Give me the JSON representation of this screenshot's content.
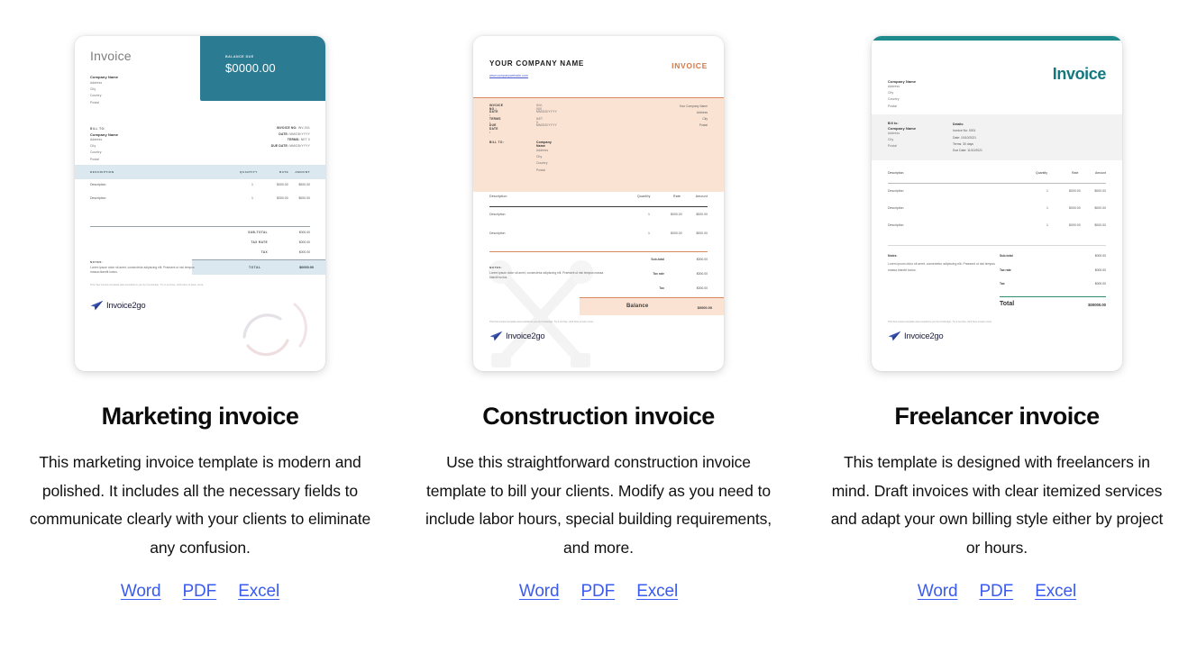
{
  "templates": [
    {
      "id": "marketing",
      "title": "Marketing invoice",
      "description": "This marketing invoice template is modern and polished. It includes all the necessary fields to communicate clearly with your clients to eliminate any confusion.",
      "links": [
        {
          "label": "Word"
        },
        {
          "label": "PDF"
        },
        {
          "label": "Excel"
        }
      ],
      "preview": {
        "heading": "Invoice",
        "balance_due_label": "BALANCE DUE",
        "balance_due_amount": "$0000.00",
        "accent_color": "#2b7b92",
        "table_header_color": "#dbe8ef",
        "from": {
          "company": "Company Name",
          "lines": [
            "Address",
            "City",
            "Country",
            "Postal"
          ]
        },
        "bill_to_label": "BILL TO:",
        "bill_to": {
          "company": "Company Name",
          "lines": [
            "Address",
            "City",
            "Country",
            "Postal"
          ]
        },
        "meta": [
          {
            "label": "INVOICE NO:",
            "value": "INV-001"
          },
          {
            "label": "DATE:",
            "value": "MM/DD/YYYY"
          },
          {
            "label": "TERMS:",
            "value": "NET 0"
          },
          {
            "label": "DUE DATE:",
            "value": "MM/DD/YYYY"
          }
        ],
        "columns": [
          "DESCRIPTION",
          "QUANTITY",
          "RATE",
          "AMOUNT"
        ],
        "rows": [
          {
            "description": "Description",
            "quantity": "1",
            "rate": "$000.00",
            "amount": "$000.00"
          },
          {
            "description": "Description",
            "quantity": "1",
            "rate": "$000.00",
            "amount": "$000.00"
          }
        ],
        "totals": [
          {
            "label": "SUB-TOTAL",
            "value": "$000.00"
          },
          {
            "label": "TAX RATE",
            "value": "$000.00"
          },
          {
            "label": "TAX",
            "value": "$000.00"
          }
        ],
        "total_label": "TOTAL",
        "total_value": "$0000.00",
        "notes_label": "NOTES:",
        "notes_text": "Lorem ipsum dolor sit amet, consectetur adipiscing elit. Praesent ut nisi tempus massa blandit luctus.",
        "disclaimer": "This free invoice template was provided to you by Invoice2go. Try it out free, click here to learn more.",
        "logo_text": "Invoice2go"
      }
    },
    {
      "id": "construction",
      "title": "Construction invoice",
      "description": "Use this straightforward construction invoice template to bill your clients. Modify as you need to include labor hours, special building requirements, and more.",
      "links": [
        {
          "label": "Word"
        },
        {
          "label": "PDF"
        },
        {
          "label": "Excel"
        }
      ],
      "preview": {
        "company_name": "YOUR COMPANY NAME",
        "website": "www.companywebsite.com",
        "heading": "INVOICE",
        "accent_color": "#d98a5c",
        "band_color": "#fbe3d3",
        "meta": [
          {
            "label": "INVOICE NO :",
            "value": "INV-000"
          },
          {
            "label": "DATE :",
            "value": "MM/DD/YYYY"
          },
          {
            "label": "TERMS :",
            "value": "NET 0"
          },
          {
            "label": "DUE DATE :",
            "value": "MM/DD/YYYY"
          }
        ],
        "from_lines": [
          "Your Company Name",
          "Address",
          "City",
          "Postal"
        ],
        "bill_to_label": "BILL TO:",
        "bill_to": {
          "company": "Company Name",
          "lines": [
            "Address",
            "City",
            "Country",
            "Postal"
          ]
        },
        "columns": [
          "Description",
          "Quantity",
          "Rate",
          "Amount"
        ],
        "rows": [
          {
            "description": "Description",
            "quantity": "1",
            "rate": "$000.00",
            "amount": "$000.00"
          },
          {
            "description": "Description",
            "quantity": "1",
            "rate": "$000.00",
            "amount": "$000.00"
          }
        ],
        "totals": [
          {
            "label": "Sub-total",
            "value": "$000.00"
          },
          {
            "label": "Tax rate",
            "value": "$000.00"
          },
          {
            "label": "Tax",
            "value": "$000.00"
          }
        ],
        "balance_label": "Balance",
        "balance_value": "$0000.00",
        "notes_label": "NOTES:",
        "notes_text": "Lorem ipsum dolor sit amet, consectetur adipiscing elit. Praesent ut nisi tempus massa blandit luctus.",
        "disclaimer": "This free invoice template was provided to you by Invoice2go. Try it out free, click here to learn more.",
        "logo_text": "Invoice2go"
      }
    },
    {
      "id": "freelancer",
      "title": "Freelancer invoice",
      "description": "This template is designed with freelancers in mind. Draft invoices with clear itemized services and adapt your own billing style either by project or hours.",
      "links": [
        {
          "label": "Word"
        },
        {
          "label": "PDF"
        },
        {
          "label": "Excel"
        }
      ],
      "preview": {
        "heading": "Invoice",
        "accent_color": "#1f8a8c",
        "band_color": "#f2f2f2",
        "from": {
          "company": "Company Name",
          "lines": [
            "Address",
            "City",
            "Country",
            "Postal"
          ]
        },
        "bill_to_label": "Bill to:",
        "bill_to": {
          "company": "Company Name",
          "lines": [
            "Address",
            "City",
            "Postal"
          ]
        },
        "details_label": "Details:",
        "details": [
          "Invoice No: 0001",
          "Date: 10/10/2021",
          "Terms: 30 days",
          "Due Date: 11/10/2021"
        ],
        "columns": [
          "Description",
          "Quantity",
          "Rate",
          "Amount"
        ],
        "rows": [
          {
            "description": "Description",
            "quantity": "1",
            "rate": "$000.00",
            "amount": "$000.00"
          },
          {
            "description": "Description",
            "quantity": "1",
            "rate": "$000.00",
            "amount": "$000.00"
          },
          {
            "description": "Description",
            "quantity": "1",
            "rate": "$000.00",
            "amount": "$000.00"
          }
        ],
        "totals": [
          {
            "label": "Sub-total",
            "value": "$000.00"
          },
          {
            "label": "Tax rate",
            "value": "$000.00"
          },
          {
            "label": "Tax",
            "value": "$000.00"
          }
        ],
        "total_label": "Total",
        "total_value": "$00000.00",
        "notes_label": "Notes:",
        "notes_text": "Lorem ipsum dolor sit amet, consectetur adipiscing elit. Praesent ut nisi tempus massa blandit luctus.",
        "disclaimer": "This free invoice template was provided to you by Invoice2go. Try it out free, click here to learn more.",
        "logo_text": "Invoice2go"
      }
    }
  ]
}
